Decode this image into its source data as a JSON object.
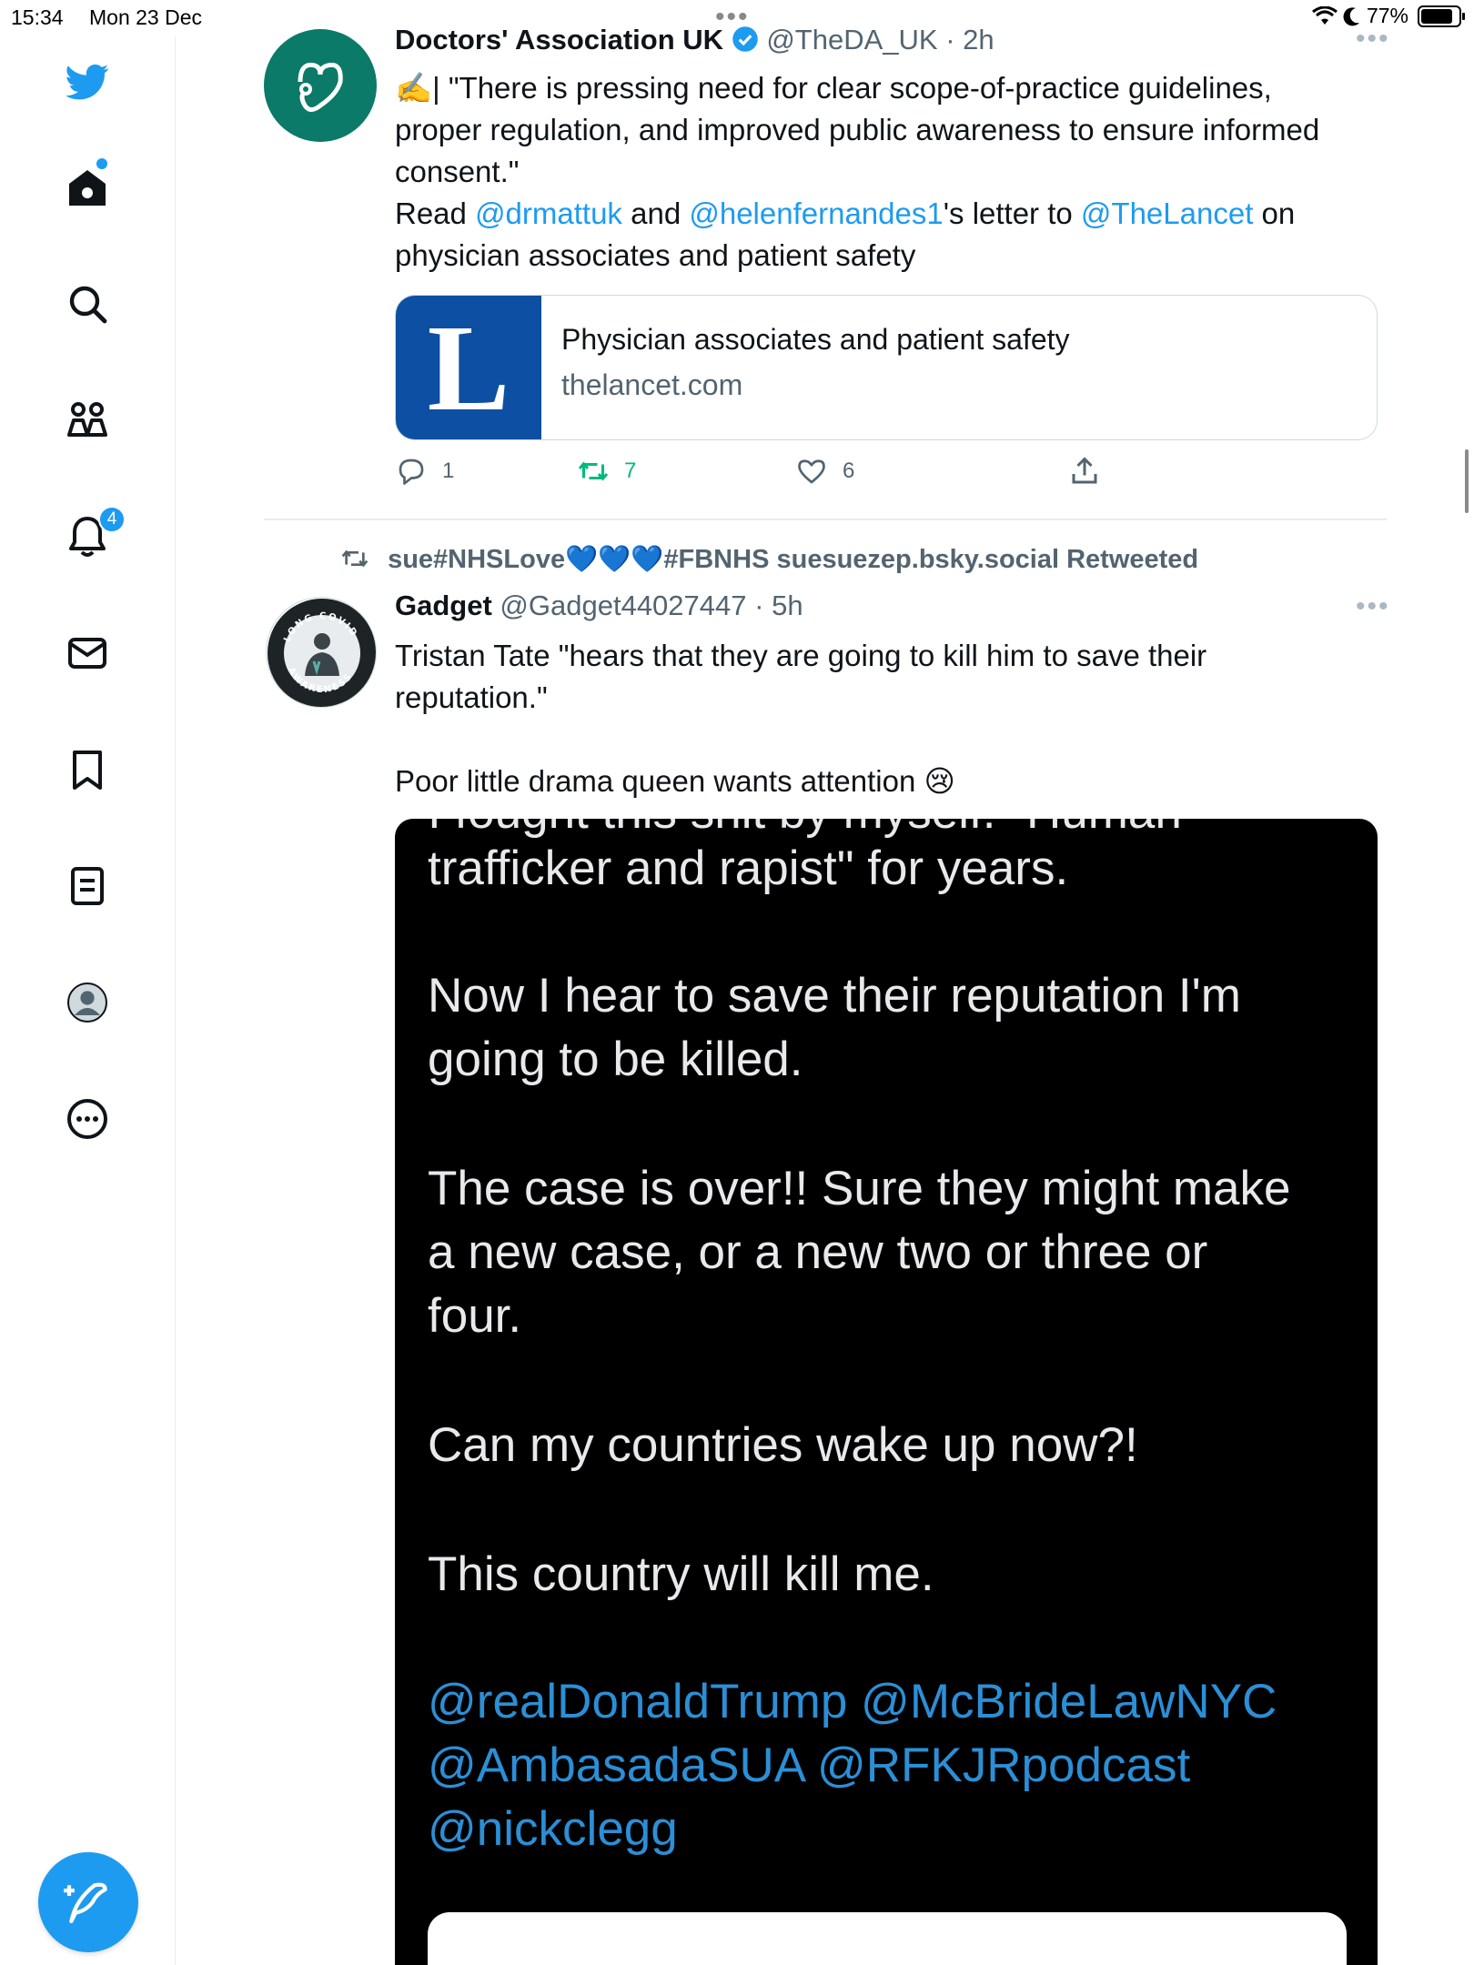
{
  "status_bar": {
    "time": "15:34",
    "date": "Mon 23 Dec",
    "battery": "77%"
  },
  "sidebar": {
    "items": [
      {
        "name": "twitter-logo-icon"
      },
      {
        "name": "home-icon"
      },
      {
        "name": "search-icon"
      },
      {
        "name": "communities-icon"
      },
      {
        "name": "notifications-icon",
        "badge": "4"
      },
      {
        "name": "messages-icon"
      },
      {
        "name": "bookmarks-icon"
      },
      {
        "name": "lists-icon"
      },
      {
        "name": "profile-icon"
      },
      {
        "name": "more-icon"
      }
    ],
    "notification_badge": "4",
    "accent_color": "#1d9bf0"
  },
  "tweet1": {
    "author_name": "Doctors' Association UK",
    "handle": "@TheDA_UK",
    "time": "· 2h",
    "text_line1": "✍️| \"There is pressing need for clear scope-of-practice guidelines,",
    "text_line2": "proper regulation, and improved public awareness to ensure informed",
    "text_line3": "consent.\"",
    "read": "Read",
    "mention1": "@drmattuk",
    "and": "and",
    "mention2": "@helenfernandes1",
    "letter_to": "'s letter to",
    "mention3": "@TheLancet",
    "on": "on",
    "text_line5": "physician associates and patient safety",
    "card": {
      "logo_letter": "L",
      "title": "Physician associates and patient safety",
      "domain": "thelancet.com"
    },
    "replies": "1",
    "retweets": "7",
    "likes": "6"
  },
  "tweet2": {
    "retweeted_by": "sue#NHSLove💙💙💙#FBNHS suesuezep.bsky.social Retweeted",
    "author_name": "Gadget",
    "handle": "@Gadget44027447",
    "time": "· 5h",
    "text_line1": "Tristan Tate \"hears that they are going to kill him to save their",
    "text_line2": "reputation.\"",
    "text_line3": "Poor little drama queen wants attention 😢",
    "avatar_ring_top": "LONG COVID",
    "avatar_ring_bottom": "AWARENESS",
    "media": {
      "cut_line": "I fought this shit by myself. \"Human",
      "line1": "trafficker and rapist\" for years.",
      "line2": "Now I hear to save their reputation I'm",
      "line3": "going to be killed.",
      "line4": "The case is over!! Sure they might make",
      "line5": "a new case, or a new two or three or",
      "line6": "four.",
      "line7": "Can my countries wake up now?!",
      "line8": "This country will kill me.",
      "mentions1": "@realDonaldTrump @McBrideLawNYC",
      "mentions2": "@AmbasadaSUA @RFKJRpodcast",
      "mentions3": "@nickclegg"
    }
  }
}
